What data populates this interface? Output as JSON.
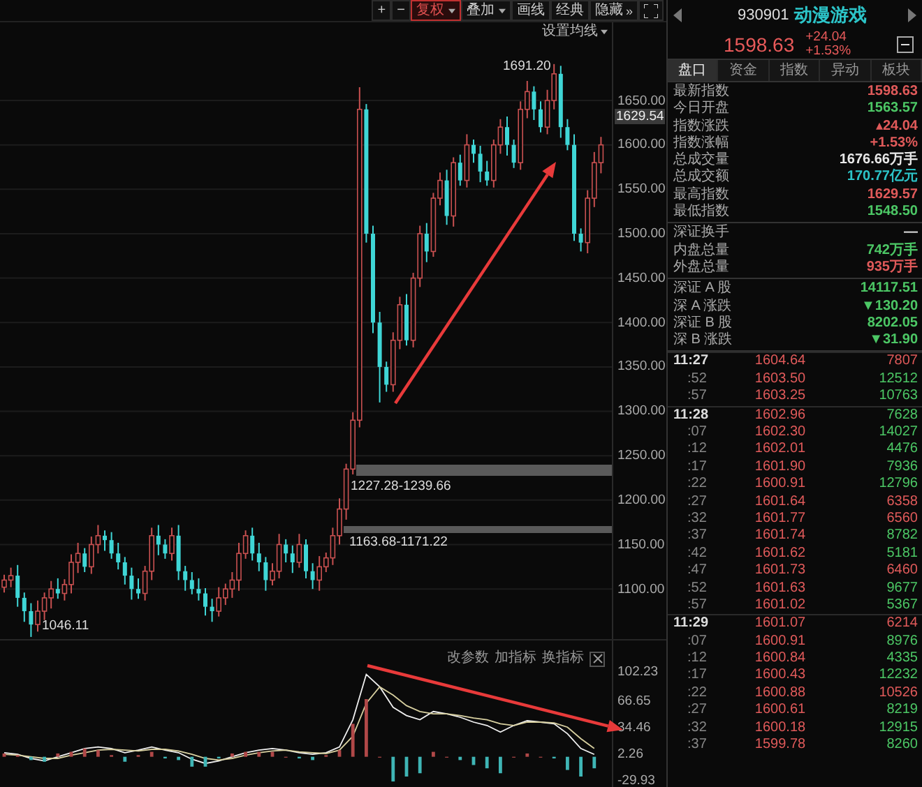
{
  "toolbar": [
    {
      "label": "+",
      "dropdown": false,
      "selected": false
    },
    {
      "label": "−",
      "dropdown": false,
      "selected": false
    },
    {
      "label": "复权",
      "dropdown": true,
      "selected": true
    },
    {
      "label": "叠加",
      "dropdown": true,
      "selected": false
    },
    {
      "label": "画线",
      "dropdown": false,
      "selected": false
    },
    {
      "label": "经典",
      "dropdown": false,
      "selected": false
    },
    {
      "label": "隐藏",
      "suffix": "»",
      "dropdown": false,
      "selected": false
    }
  ],
  "ma_setting": {
    "label": "设置均线",
    "dropdown": true
  },
  "price_chart": {
    "current": "1629.54",
    "chart_data": {
      "type": "candlestick",
      "ylim": [
        1042,
        1738
      ],
      "grid": true,
      "yticks": [
        {
          "value": 1650,
          "label": "1650.00"
        },
        {
          "value": 1600,
          "label": "1600.00"
        },
        {
          "value": 1550,
          "label": "1550.00"
        },
        {
          "value": 1500,
          "label": "1500.00"
        },
        {
          "value": 1450,
          "label": "1450.00"
        },
        {
          "value": 1400,
          "label": "1400.00"
        },
        {
          "value": 1350,
          "label": "1350.00"
        },
        {
          "value": 1300,
          "label": "1300.00"
        },
        {
          "value": 1250,
          "label": "1250.00"
        },
        {
          "value": 1200,
          "label": "1200.00"
        },
        {
          "value": 1150,
          "label": "1150.00"
        },
        {
          "value": 1100,
          "label": "1100.00"
        }
      ],
      "ohlc": [
        [
          1102,
          1116,
          1096,
          1110
        ],
        [
          1110,
          1124,
          1102,
          1115
        ],
        [
          1115,
          1127,
          1080,
          1090
        ],
        [
          1090,
          1096,
          1063,
          1075
        ],
        [
          1075,
          1084,
          1046,
          1060
        ],
        [
          1060,
          1087,
          1052,
          1075
        ],
        [
          1075,
          1096,
          1065,
          1090
        ],
        [
          1090,
          1109,
          1078,
          1100
        ],
        [
          1100,
          1112,
          1089,
          1095
        ],
        [
          1095,
          1111,
          1087,
          1105
        ],
        [
          1105,
          1139,
          1095,
          1130
        ],
        [
          1130,
          1152,
          1118,
          1140
        ],
        [
          1140,
          1146,
          1119,
          1125
        ],
        [
          1125,
          1159,
          1117,
          1150
        ],
        [
          1150,
          1172,
          1140,
          1160
        ],
        [
          1160,
          1166,
          1143,
          1155
        ],
        [
          1155,
          1164,
          1134,
          1140
        ],
        [
          1140,
          1152,
          1122,
          1130
        ],
        [
          1130,
          1136,
          1105,
          1115
        ],
        [
          1115,
          1124,
          1088,
          1100
        ],
        [
          1100,
          1112,
          1089,
          1095
        ],
        [
          1095,
          1126,
          1087,
          1120
        ],
        [
          1120,
          1169,
          1110,
          1160
        ],
        [
          1160,
          1172,
          1138,
          1150
        ],
        [
          1150,
          1156,
          1134,
          1140
        ],
        [
          1140,
          1169,
          1132,
          1160
        ],
        [
          1160,
          1172,
          1110,
          1120
        ],
        [
          1120,
          1126,
          1098,
          1110
        ],
        [
          1110,
          1119,
          1094,
          1100
        ],
        [
          1100,
          1112,
          1087,
          1095
        ],
        [
          1095,
          1101,
          1070,
          1080
        ],
        [
          1080,
          1089,
          1063,
          1075
        ],
        [
          1075,
          1102,
          1069,
          1090
        ],
        [
          1090,
          1106,
          1082,
          1100
        ],
        [
          1100,
          1119,
          1090,
          1110
        ],
        [
          1110,
          1152,
          1098,
          1140
        ],
        [
          1140,
          1166,
          1134,
          1160
        ],
        [
          1160,
          1169,
          1132,
          1140
        ],
        [
          1140,
          1152,
          1120,
          1130
        ],
        [
          1130,
          1136,
          1098,
          1110
        ],
        [
          1110,
          1129,
          1104,
          1120
        ],
        [
          1120,
          1162,
          1112,
          1150
        ],
        [
          1150,
          1156,
          1130,
          1140
        ],
        [
          1140,
          1149,
          1118,
          1130
        ],
        [
          1130,
          1162,
          1124,
          1150
        ],
        [
          1150,
          1156,
          1112,
          1120
        ],
        [
          1120,
          1129,
          1100,
          1110
        ],
        [
          1110,
          1137,
          1098,
          1125
        ],
        [
          1125,
          1141,
          1119,
          1135
        ],
        [
          1135,
          1169,
          1127,
          1160
        ],
        [
          1160,
          1202,
          1150,
          1190
        ],
        [
          1190,
          1241,
          1178,
          1235
        ],
        [
          1235,
          1299,
          1229,
          1290
        ],
        [
          1290,
          1665,
          1282,
          1640
        ],
        [
          1640,
          1646,
          1490,
          1500
        ],
        [
          1500,
          1509,
          1388,
          1400
        ],
        [
          1400,
          1412,
          1310,
          1350
        ],
        [
          1350,
          1356,
          1322,
          1330
        ],
        [
          1330,
          1389,
          1322,
          1380
        ],
        [
          1380,
          1429,
          1370,
          1420
        ],
        [
          1420,
          1432,
          1374,
          1380
        ],
        [
          1380,
          1456,
          1372,
          1450
        ],
        [
          1450,
          1509,
          1440,
          1500
        ],
        [
          1500,
          1512,
          1468,
          1480
        ],
        [
          1480,
          1546,
          1474,
          1540
        ],
        [
          1540,
          1569,
          1532,
          1560
        ],
        [
          1560,
          1572,
          1510,
          1520
        ],
        [
          1520,
          1586,
          1508,
          1580
        ],
        [
          1580,
          1589,
          1554,
          1560
        ],
        [
          1560,
          1612,
          1552,
          1600
        ],
        [
          1600,
          1606,
          1580,
          1590
        ],
        [
          1590,
          1599,
          1558,
          1570
        ],
        [
          1570,
          1582,
          1554,
          1560
        ],
        [
          1560,
          1606,
          1552,
          1600
        ],
        [
          1600,
          1629,
          1590,
          1620
        ],
        [
          1620,
          1632,
          1588,
          1600
        ],
        [
          1600,
          1606,
          1574,
          1580
        ],
        [
          1580,
          1649,
          1572,
          1640
        ],
        [
          1640,
          1672,
          1630,
          1660
        ],
        [
          1660,
          1666,
          1628,
          1640
        ],
        [
          1640,
          1649,
          1614,
          1620
        ],
        [
          1620,
          1662,
          1612,
          1650
        ],
        [
          1650,
          1691,
          1640,
          1680
        ],
        [
          1680,
          1689,
          1608,
          1620
        ],
        [
          1620,
          1629,
          1594,
          1600
        ],
        [
          1600,
          1612,
          1492,
          1500
        ],
        [
          1500,
          1506,
          1480,
          1490
        ],
        [
          1490,
          1549,
          1478,
          1540
        ],
        [
          1540,
          1592,
          1530,
          1580
        ],
        [
          1580,
          1609,
          1568,
          1600
        ]
      ]
    }
  },
  "annotations": [
    "1691.20",
    "1227.28-1239.66",
    "1163.68-1171.22",
    "1046.11"
  ],
  "indicator": {
    "buttons": [
      "改参数",
      "加指标",
      "换指标"
    ],
    "chart_data": {
      "type": "line",
      "ylim": [
        -38.4,
        141.2
      ],
      "yticks": [
        {
          "value": 102.23,
          "label": "102.23"
        },
        {
          "value": 66.65,
          "label": "66.65"
        },
        {
          "value": 34.46,
          "label": "34.46"
        },
        {
          "value": 2.26,
          "label": "2.26"
        },
        {
          "value": -29.93,
          "label": "-29.93"
        }
      ],
      "series": [
        {
          "color": "#f0f0f0",
          "values": [
            5,
            3,
            -2,
            -5,
            0,
            5,
            10,
            12,
            10,
            5,
            8,
            12,
            8,
            5,
            -3,
            -8,
            -5,
            0,
            5,
            8,
            10,
            8,
            5,
            3,
            5,
            12,
            45,
            100,
            85,
            60,
            50,
            45,
            55,
            52,
            48,
            42,
            38,
            30,
            38,
            44,
            42,
            40,
            28,
            10,
            3
          ]
        },
        {
          "color": "#d8d0a0",
          "values": [
            3,
            2,
            0,
            -2,
            -2,
            2,
            5,
            8,
            9,
            8,
            7,
            9,
            9,
            7,
            3,
            -2,
            -4,
            -2,
            2,
            5,
            7,
            8,
            6,
            5,
            4,
            8,
            25,
            65,
            85,
            75,
            62,
            55,
            52,
            52,
            50,
            47,
            45,
            40,
            38,
            42,
            42,
            41,
            36,
            22,
            10
          ]
        },
        {
          "type": "bar",
          "color": "#b04848",
          "values": [
            4,
            2,
            null,
            null,
            4,
            6,
            10,
            8,
            2,
            null,
            2,
            6,
            null,
            null,
            null,
            null,
            null,
            4,
            6,
            6,
            6,
            0,
            null,
            null,
            2,
            8,
            40,
            70,
            0,
            null,
            null,
            null,
            6,
            0,
            null,
            null,
            null,
            null,
            0,
            4,
            0,
            null,
            null,
            null,
            null
          ]
        },
        {
          "type": "bar",
          "color": "#3fb5b5",
          "values": [
            null,
            null,
            -4,
            -6,
            null,
            null,
            null,
            null,
            null,
            -6,
            null,
            null,
            -2,
            -4,
            -12,
            -12,
            -2,
            null,
            null,
            null,
            null,
            null,
            -2,
            -4,
            null,
            null,
            null,
            null,
            null,
            -30,
            -24,
            -20,
            null,
            null,
            -4,
            -10,
            -14,
            -20,
            null,
            null,
            null,
            -2,
            -16,
            -24,
            -14
          ]
        }
      ]
    }
  },
  "quote": {
    "code": "930901",
    "name": "动漫游戏",
    "price": "1598.63",
    "change": "+24.04",
    "change_pct": "+1.53%"
  },
  "tabs": [
    {
      "label": "盘口",
      "selected": true
    },
    {
      "label": "资金",
      "selected": false
    },
    {
      "label": "指数",
      "selected": false
    },
    {
      "label": "异动",
      "selected": false
    },
    {
      "label": "板块",
      "selected": false
    }
  ],
  "stats": [
    [
      {
        "label": "最新指数",
        "value": "1598.63",
        "color": "#e05a5a"
      },
      {
        "label": "今日开盘",
        "value": "1563.57",
        "color": "#4cc765"
      },
      {
        "label": "指数涨跌",
        "value": "▴24.04",
        "color": "#e05a5a"
      },
      {
        "label": "指数涨幅",
        "value": "+1.53%",
        "color": "#e05a5a"
      },
      {
        "label": "总成交量",
        "value": "1676.66万手",
        "color": "#e8e8e8"
      },
      {
        "label": "总成交额",
        "value": "170.77亿元",
        "color": "#2cc4c8"
      },
      {
        "label": "最高指数",
        "value": "1629.57",
        "color": "#e05a5a"
      },
      {
        "label": "最低指数",
        "value": "1548.50",
        "color": "#4cc765"
      }
    ],
    [
      {
        "label": "深证换手",
        "value": "—",
        "color": "#dddddd"
      },
      {
        "label": "内盘总量",
        "value": "742万手",
        "color": "#4cc765"
      },
      {
        "label": "外盘总量",
        "value": "935万手",
        "color": "#e05a5a"
      }
    ],
    [
      {
        "label": "深证 A 股",
        "value": "14117.51",
        "color": "#4cc765"
      },
      {
        "label": "深 A 涨跌",
        "value": "▼130.20",
        "color": "#4cc765"
      },
      {
        "label": "深证 B 股",
        "value": "8202.05",
        "color": "#4cc765"
      },
      {
        "label": "深 B 涨跌",
        "value": "▼31.90",
        "color": "#4cc765"
      }
    ]
  ],
  "ticks": [
    {
      "kind": "minute",
      "time": "11:27",
      "price": "1604.64",
      "volume": "7807",
      "color": "#e05a5a"
    },
    {
      "kind": "second",
      "time": ":52",
      "price": "1603.50",
      "volume": "12512",
      "color": "#4cc765"
    },
    {
      "kind": "second",
      "time": ":57",
      "price": "1603.25",
      "volume": "10763",
      "color": "#4cc765"
    },
    {
      "kind": "minute",
      "time": "11:28",
      "price": "1602.96",
      "volume": "7628",
      "color": "#4cc765"
    },
    {
      "kind": "second",
      "time": ":07",
      "price": "1602.30",
      "volume": "14027",
      "color": "#4cc765"
    },
    {
      "kind": "second",
      "time": ":12",
      "price": "1602.01",
      "volume": "4476",
      "color": "#4cc765"
    },
    {
      "kind": "second",
      "time": ":17",
      "price": "1601.90",
      "volume": "7936",
      "color": "#4cc765"
    },
    {
      "kind": "second",
      "time": ":22",
      "price": "1600.91",
      "volume": "12796",
      "color": "#4cc765"
    },
    {
      "kind": "second",
      "time": ":27",
      "price": "1601.64",
      "volume": "6358",
      "color": "#e05a5a"
    },
    {
      "kind": "second",
      "time": ":32",
      "price": "1601.77",
      "volume": "6560",
      "color": "#e05a5a"
    },
    {
      "kind": "second",
      "time": ":37",
      "price": "1601.74",
      "volume": "8782",
      "color": "#4cc765"
    },
    {
      "kind": "second",
      "time": ":42",
      "price": "1601.62",
      "volume": "5181",
      "color": "#4cc765"
    },
    {
      "kind": "second",
      "time": ":47",
      "price": "1601.73",
      "volume": "6460",
      "color": "#e05a5a"
    },
    {
      "kind": "second",
      "time": ":52",
      "price": "1601.63",
      "volume": "9677",
      "color": "#4cc765"
    },
    {
      "kind": "second",
      "time": ":57",
      "price": "1601.02",
      "volume": "5367",
      "color": "#4cc765"
    },
    {
      "kind": "minute",
      "time": "11:29",
      "price": "1601.07",
      "volume": "6214",
      "color": "#e05a5a"
    },
    {
      "kind": "second",
      "time": ":07",
      "price": "1600.91",
      "volume": "8976",
      "color": "#4cc765"
    },
    {
      "kind": "second",
      "time": ":12",
      "price": "1600.84",
      "volume": "4335",
      "color": "#4cc765"
    },
    {
      "kind": "second",
      "time": ":17",
      "price": "1600.43",
      "volume": "12232",
      "color": "#4cc765"
    },
    {
      "kind": "second",
      "time": ":22",
      "price": "1600.88",
      "volume": "10526",
      "color": "#e05a5a"
    },
    {
      "kind": "second",
      "time": ":27",
      "price": "1600.61",
      "volume": "8219",
      "color": "#4cc765"
    },
    {
      "kind": "second",
      "time": ":32",
      "price": "1600.18",
      "volume": "12915",
      "color": "#4cc765"
    },
    {
      "kind": "second",
      "time": ":37",
      "price": "1599.78",
      "volume": "8260",
      "color": "#4cc765"
    }
  ]
}
